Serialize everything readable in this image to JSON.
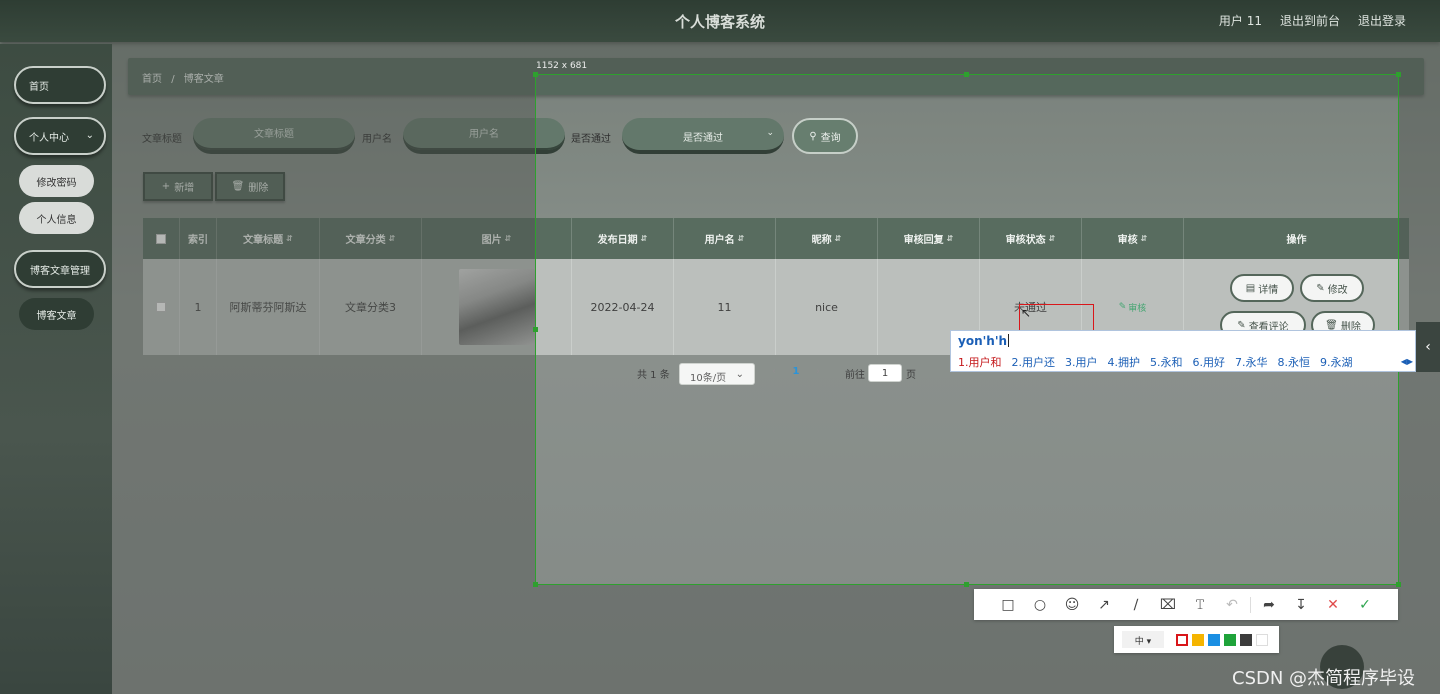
{
  "header": {
    "title": "个人博客系统",
    "user": "用户 11",
    "to_front": "退出到前台",
    "logout": "退出登录"
  },
  "sidebar": {
    "home": "首页",
    "personal_center": "个人中心",
    "change_password": "修改密码",
    "personal_info": "个人信息",
    "blog_manage": "博客文章管理",
    "blog_article": "博客文章"
  },
  "breadcrumb": {
    "home": "首页",
    "sep": "/",
    "current": "博客文章"
  },
  "search": {
    "title_label": "文章标题",
    "title_placeholder": "文章标题",
    "username_label": "用户名",
    "username_placeholder": "用户名",
    "approved_label": "是否通过",
    "approved_value": "是否通过",
    "query_button": "查询"
  },
  "actions": {
    "add": "新增",
    "delete": "删除"
  },
  "table": {
    "headers": [
      "索引",
      "文章标题",
      "文章分类",
      "图片",
      "发布日期",
      "用户名",
      "昵称",
      "审核回复",
      "审核状态",
      "审核",
      "操作"
    ],
    "rows": [
      {
        "index": "1",
        "title": "阿斯蒂芬阿斯达",
        "category": "文章分类3",
        "date": "2022-04-24",
        "username": "11",
        "nickname": "nice",
        "reply": "",
        "status": "未通过",
        "audit": "审核",
        "ops": [
          "详情",
          "修改",
          "查看评论",
          "删除"
        ]
      }
    ]
  },
  "pager": {
    "total": "共 1 条",
    "page_size": "10条/页",
    "current": "1",
    "goto_prefix": "前往",
    "goto_value": "1",
    "goto_suffix": "页"
  },
  "overlay": {
    "dimensions": "1152 x 681",
    "ime_composition": "yon'h'h",
    "ime_candidates": [
      "1.用户和",
      "2.用户还",
      "3.用户",
      "4.拥护",
      "5.永和",
      "6.用好",
      "7.永华",
      "8.永恒",
      "9.永湖"
    ],
    "size_label": "中",
    "colors": [
      "#d9161a",
      "#f5b400",
      "#1a8fe3",
      "#1ea33a",
      "#3c3c3c",
      "#ffffff"
    ]
  },
  "watermark": "CSDN @杰简程序毕设"
}
